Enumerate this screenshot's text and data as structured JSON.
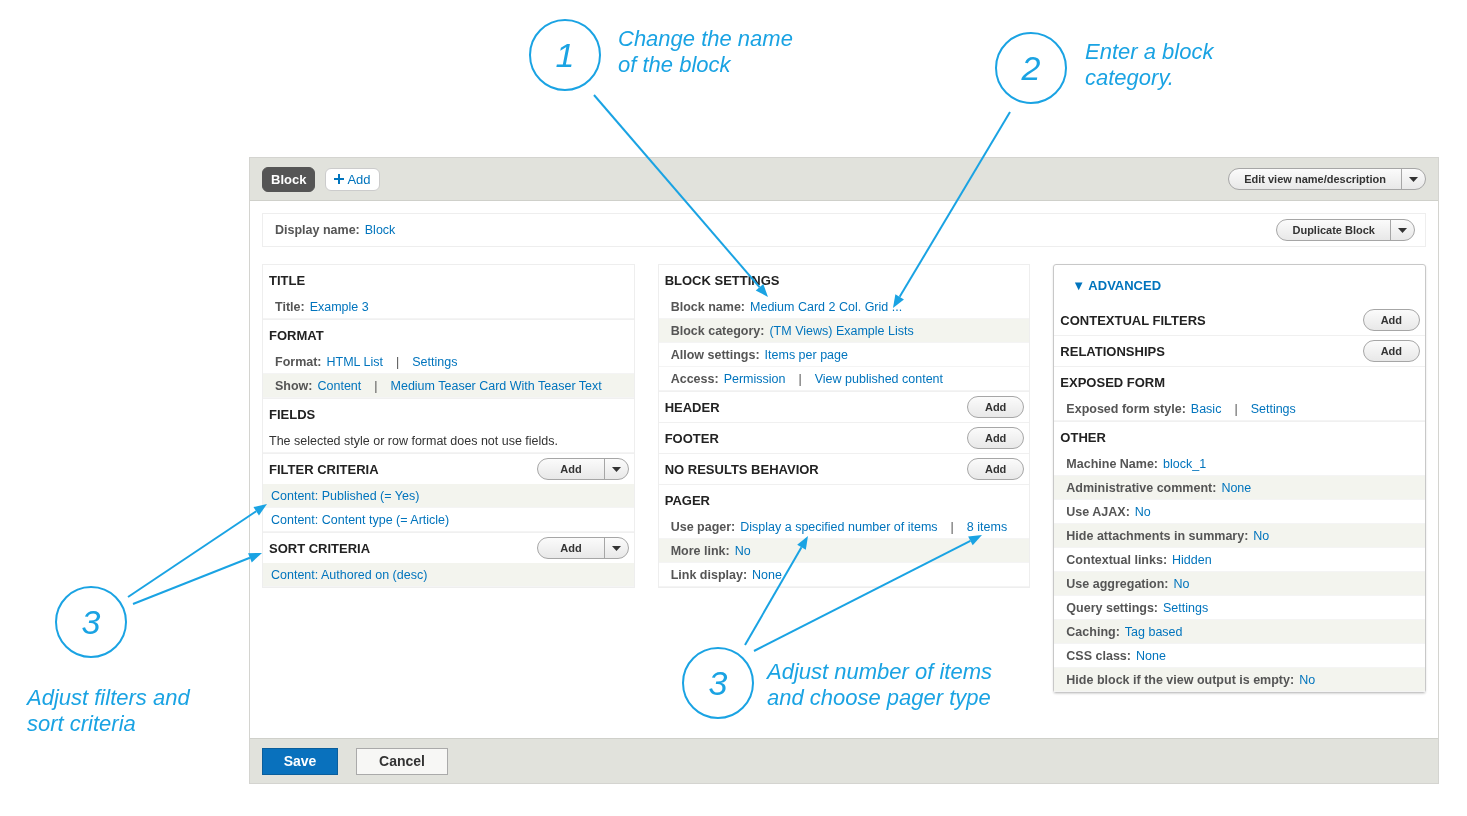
{
  "annotations": [
    {
      "number": "1",
      "lines": [
        "Change the name",
        "of the block"
      ]
    },
    {
      "number": "2",
      "lines": [
        "Enter a block",
        "category."
      ]
    },
    {
      "number": "3",
      "lines": [
        "Adjust filters and",
        "sort criteria"
      ]
    },
    {
      "number": "3",
      "lines": [
        "Adjust number of items",
        "and choose pager type"
      ]
    }
  ],
  "top_bar": {
    "tabs": [
      {
        "label": "Block",
        "selected": true
      }
    ],
    "add_display": "Add",
    "menu_button": "Edit view name/description"
  },
  "display_name": {
    "label": "Display name:",
    "value": "Block",
    "menu_button": "Duplicate Block"
  },
  "columns": [
    {
      "kind": "plain",
      "sections": [
        {
          "title": "TITLE",
          "rows": [
            {
              "kind": "setting",
              "label": "Title:",
              "shaded": false,
              "parts": [
                {
                  "kind": "link",
                  "text": "Example 3"
                }
              ]
            }
          ]
        },
        {
          "title": "FORMAT",
          "rows": [
            {
              "kind": "setting",
              "label": "Format:",
              "shaded": false,
              "parts": [
                {
                  "kind": "link",
                  "text": "HTML List"
                },
                {
                  "kind": "sep",
                  "text": "|"
                },
                {
                  "kind": "link",
                  "text": "Settings"
                }
              ]
            },
            {
              "kind": "setting",
              "label": "Show:",
              "shaded": true,
              "parts": [
                {
                  "kind": "link",
                  "text": "Content"
                },
                {
                  "kind": "sep",
                  "text": "|"
                },
                {
                  "kind": "link",
                  "text": "Medium Teaser Card With Teaser Text"
                }
              ]
            }
          ]
        },
        {
          "title": "FIELDS",
          "rows": [
            {
              "kind": "note",
              "text": "The selected style or row format does not use fields.",
              "shaded": false
            }
          ]
        },
        {
          "title": "FILTER CRITERIA",
          "add": {
            "label": "Add",
            "dropdown": true
          },
          "rows": [
            {
              "kind": "link",
              "text": "Content: Published (= Yes)",
              "shaded": true
            },
            {
              "kind": "link",
              "text": "Content: Content type (= Article)",
              "shaded": false
            }
          ]
        },
        {
          "title": "SORT CRITERIA",
          "add": {
            "label": "Add",
            "dropdown": true
          },
          "rows": [
            {
              "kind": "link",
              "text": "Content: Authored on (desc)",
              "shaded": true
            }
          ]
        }
      ]
    },
    {
      "kind": "plain",
      "sections": [
        {
          "title": "BLOCK SETTINGS",
          "rows": [
            {
              "kind": "setting",
              "label": "Block name:",
              "shaded": false,
              "parts": [
                {
                  "kind": "link",
                  "text": "Medium Card 2 Col. Grid ..."
                }
              ]
            },
            {
              "kind": "setting",
              "label": "Block category:",
              "shaded": true,
              "parts": [
                {
                  "kind": "link",
                  "text": "(TM Views) Example Lists"
                }
              ]
            },
            {
              "kind": "setting",
              "label": "Allow settings:",
              "shaded": false,
              "parts": [
                {
                  "kind": "link",
                  "text": "Items per page"
                }
              ]
            },
            {
              "kind": "setting",
              "label": "Access:",
              "shaded": false,
              "parts": [
                {
                  "kind": "link",
                  "text": "Permission"
                },
                {
                  "kind": "sep",
                  "text": "|"
                },
                {
                  "kind": "link",
                  "text": "View published content"
                }
              ]
            }
          ]
        },
        {
          "title": "HEADER",
          "add": {
            "label": "Add",
            "dropdown": false
          }
        },
        {
          "title": "FOOTER",
          "add": {
            "label": "Add",
            "dropdown": false
          }
        },
        {
          "title": "NO RESULTS BEHAVIOR",
          "add": {
            "label": "Add",
            "dropdown": false
          }
        },
        {
          "title": "PAGER",
          "rows": [
            {
              "kind": "setting",
              "label": "Use pager:",
              "shaded": false,
              "parts": [
                {
                  "kind": "link",
                  "text": "Display a specified number of items"
                },
                {
                  "kind": "sep",
                  "text": "|"
                },
                {
                  "kind": "link",
                  "text": "8 items"
                }
              ]
            },
            {
              "kind": "setting",
              "label": "More link:",
              "shaded": true,
              "parts": [
                {
                  "kind": "link",
                  "text": "No"
                }
              ]
            },
            {
              "kind": "setting",
              "label": "Link display:",
              "shaded": false,
              "parts": [
                {
                  "kind": "link",
                  "text": "None"
                }
              ]
            }
          ]
        }
      ]
    },
    {
      "kind": "advanced",
      "toggle": {
        "icon": "▼",
        "label": "ADVANCED",
        "expanded": true
      },
      "sections": [
        {
          "title": "CONTEXTUAL FILTERS",
          "add": {
            "label": "Add",
            "dropdown": false
          }
        },
        {
          "title": "RELATIONSHIPS",
          "add": {
            "label": "Add",
            "dropdown": false
          }
        },
        {
          "title": "EXPOSED FORM",
          "rows": [
            {
              "kind": "setting",
              "label": "Exposed form style:",
              "shaded": false,
              "parts": [
                {
                  "kind": "link",
                  "text": "Basic"
                },
                {
                  "kind": "sep",
                  "text": "|"
                },
                {
                  "kind": "link",
                  "text": "Settings"
                }
              ]
            }
          ]
        },
        {
          "title": "OTHER",
          "rows": [
            {
              "kind": "setting",
              "label": "Machine Name:",
              "shaded": false,
              "parts": [
                {
                  "kind": "link",
                  "text": "block_1"
                }
              ]
            },
            {
              "kind": "setting",
              "label": "Administrative comment:",
              "shaded": true,
              "parts": [
                {
                  "kind": "link",
                  "text": "None"
                }
              ]
            },
            {
              "kind": "setting",
              "label": "Use AJAX:",
              "shaded": false,
              "parts": [
                {
                  "kind": "link",
                  "text": "No"
                }
              ]
            },
            {
              "kind": "setting",
              "label": "Hide attachments in summary:",
              "shaded": true,
              "parts": [
                {
                  "kind": "link",
                  "text": "No"
                }
              ]
            },
            {
              "kind": "setting",
              "label": "Contextual links:",
              "shaded": false,
              "parts": [
                {
                  "kind": "link",
                  "text": "Hidden"
                }
              ]
            },
            {
              "kind": "setting",
              "label": "Use aggregation:",
              "shaded": true,
              "parts": [
                {
                  "kind": "link",
                  "text": "No"
                }
              ]
            },
            {
              "kind": "setting",
              "label": "Query settings:",
              "shaded": false,
              "parts": [
                {
                  "kind": "link",
                  "text": "Settings"
                }
              ]
            },
            {
              "kind": "setting",
              "label": "Caching:",
              "shaded": true,
              "parts": [
                {
                  "kind": "link",
                  "text": "Tag based"
                }
              ]
            },
            {
              "kind": "setting",
              "label": "CSS class:",
              "shaded": false,
              "parts": [
                {
                  "kind": "link",
                  "text": "None"
                }
              ]
            },
            {
              "kind": "setting",
              "label": "Hide block if the view output is empty:",
              "shaded": true,
              "parts": [
                {
                  "kind": "link",
                  "text": "No"
                }
              ]
            }
          ]
        }
      ]
    }
  ],
  "actions": [
    {
      "label": "Save",
      "kind": "primary"
    },
    {
      "label": "Cancel",
      "kind": "secondary"
    }
  ]
}
